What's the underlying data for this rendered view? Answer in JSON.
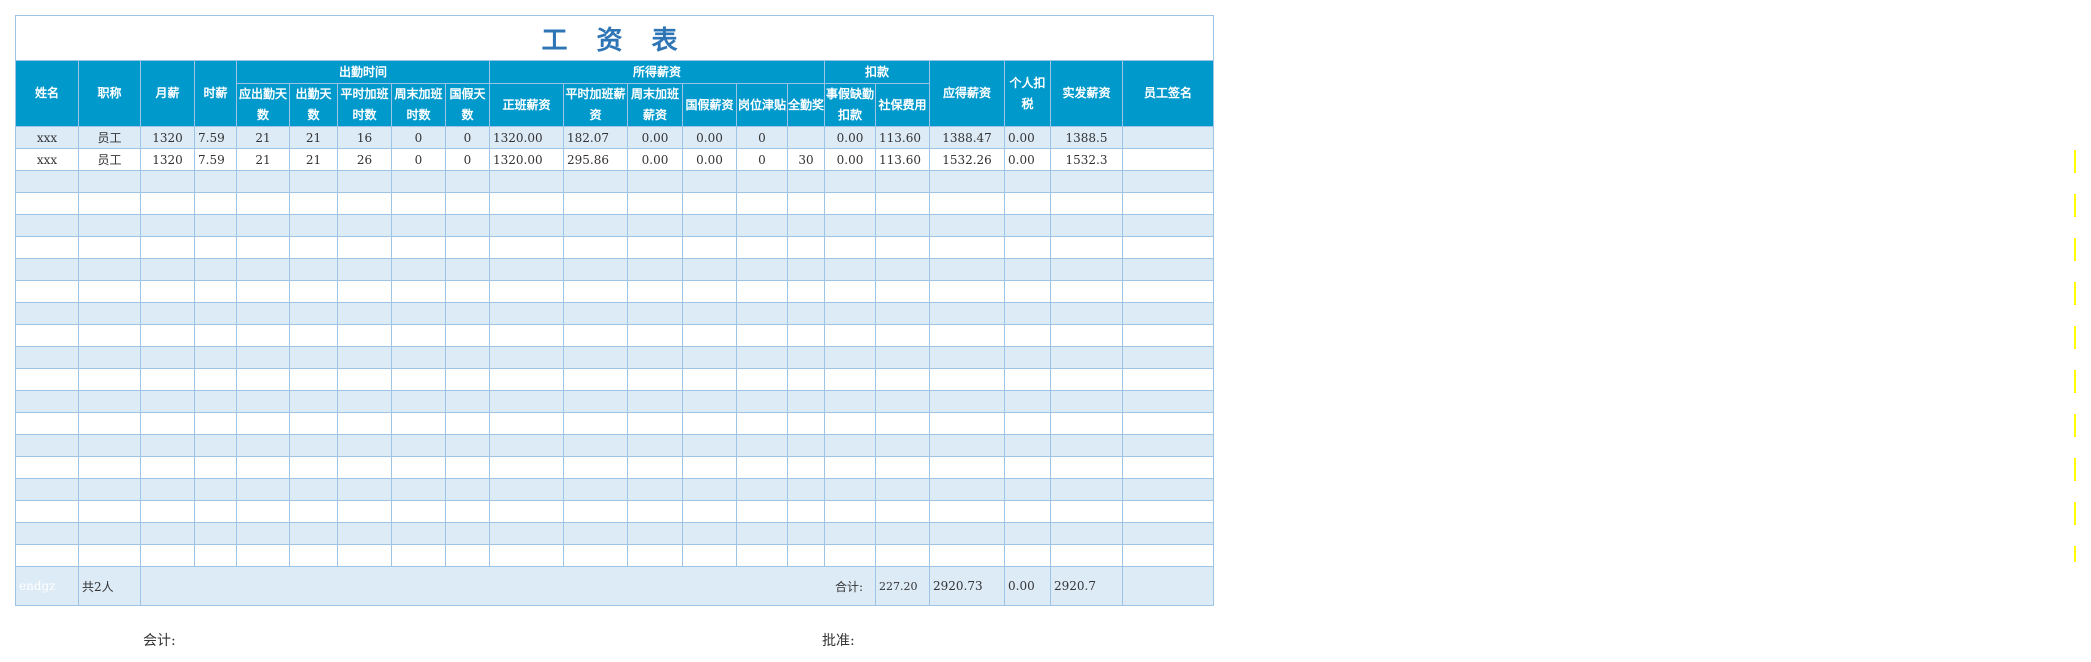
{
  "title": "工 资 表",
  "header": {
    "name": "姓名",
    "position": "职称",
    "monthly_salary": "月薪",
    "hourly_wage": "时薪",
    "group_attendance": "出勤时间",
    "group_earned": "所得薪资",
    "group_deduction": "扣款",
    "attendance_days_required": "应出勤天数",
    "attendance_days": "出勤天数",
    "weekday_ot_hours": "平时加班时数",
    "weekend_ot_hours": "周末加班时数",
    "holiday_days": "国假天数",
    "regular_pay": "正班薪资",
    "weekday_ot_pay": "平时加班薪资",
    "weekend_ot_pay": "周末加班薪资",
    "holiday_pay": "国假薪资",
    "post_allowance": "岗位津贴",
    "full_attendance_bonus": "全勤奖",
    "leave_deduction": "事假缺勤扣款",
    "social_insurance": "社保费用",
    "gross_pay": "应得薪资",
    "income_tax": "个人扣税",
    "net_pay": "实发薪资",
    "signature": "员工签名"
  },
  "rows": [
    {
      "name": "xxx",
      "position": "员工",
      "monthly": "1320",
      "hourly": "7.59",
      "req_days": "21",
      "days": "21",
      "wd_ot": "16",
      "we_ot": "0",
      "hol": "0",
      "regular": "1320.00",
      "wd_ot_pay": "182.07",
      "we_ot_pay": "0.00",
      "hol_pay": "0.00",
      "allowance": "0",
      "bonus": "",
      "leave_ded": "0.00",
      "social": "113.60",
      "gross": "1388.47",
      "tax": "0.00",
      "net": "1388.5",
      "sign": ""
    },
    {
      "name": "xxx",
      "position": "员工",
      "monthly": "1320",
      "hourly": "7.59",
      "req_days": "21",
      "days": "21",
      "wd_ot": "26",
      "we_ot": "0",
      "hol": "0",
      "regular": "1320.00",
      "wd_ot_pay": "295.86",
      "we_ot_pay": "0.00",
      "hol_pay": "0.00",
      "allowance": "0",
      "bonus": "30",
      "leave_ded": "0.00",
      "social": "113.60",
      "gross": "1532.26",
      "tax": "0.00",
      "net": "1532.3",
      "sign": ""
    }
  ],
  "empty_rows": 18,
  "footer": {
    "marker": "endgz",
    "count": "共2人",
    "total_label": "合计:",
    "social_total": "227.20",
    "gross_total": "2920.73",
    "tax_total": "0.00",
    "net_total": "2920.7"
  },
  "signatures": {
    "accountant": "会计:",
    "approval": "批准:"
  }
}
